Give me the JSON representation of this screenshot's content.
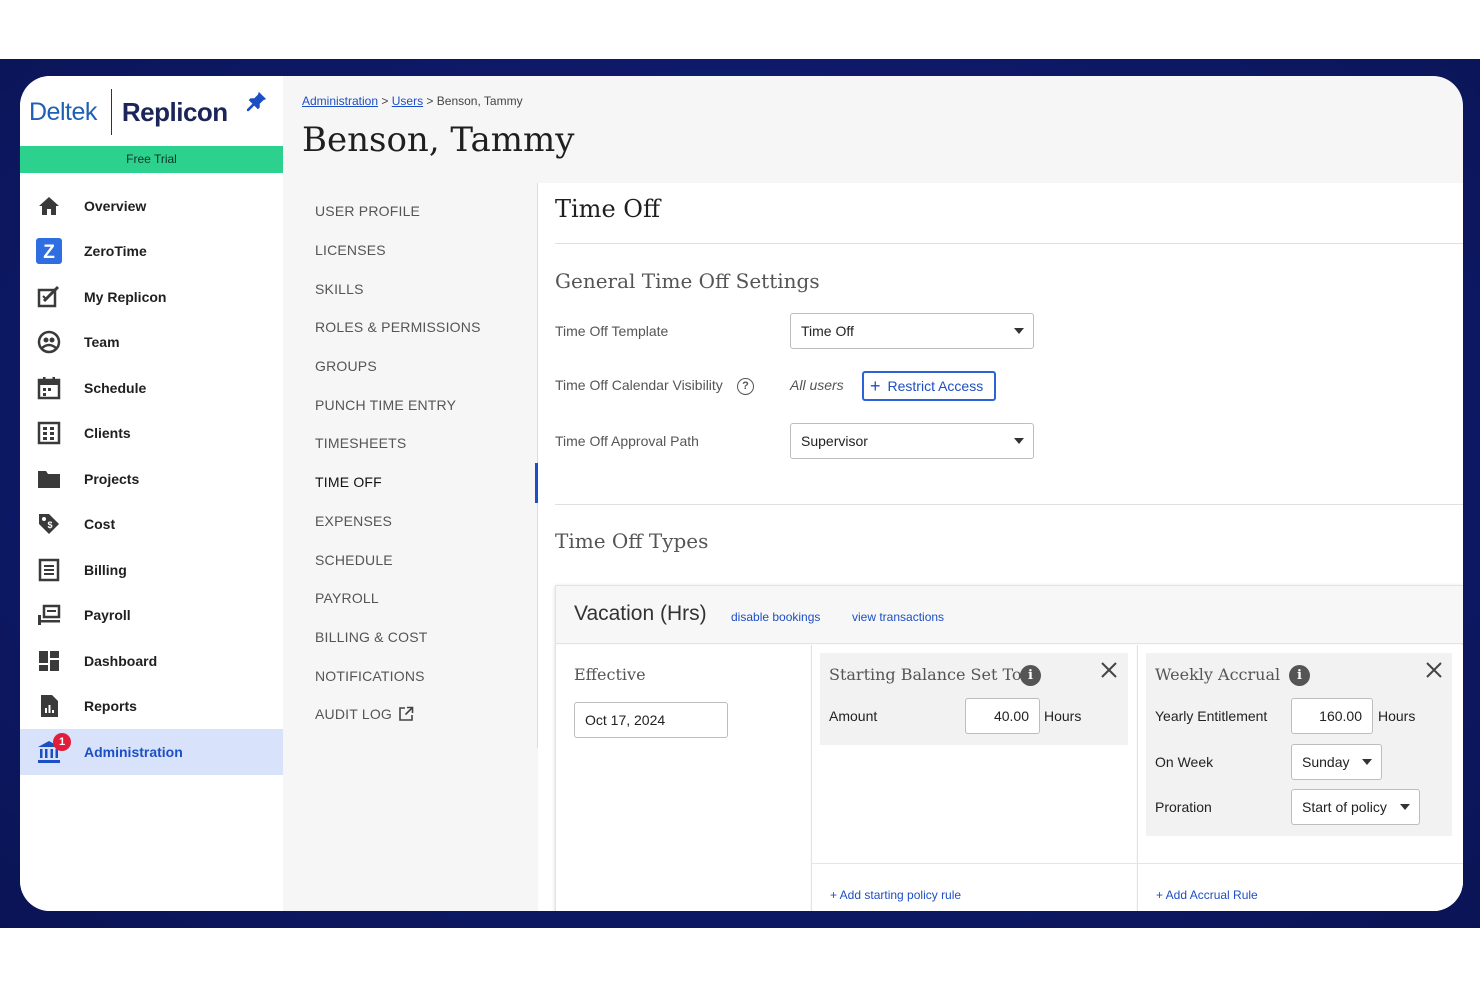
{
  "brand": {
    "company": "Deltek",
    "product": "Replicon",
    "trial_label": "Free Trial",
    "accent_color": "#2bd18c",
    "primary_color": "#1d4fc4"
  },
  "sidebar": {
    "items": [
      {
        "label": "Overview",
        "icon": "home-icon"
      },
      {
        "label": "ZeroTime",
        "icon": "zerotime-icon"
      },
      {
        "label": "My Replicon",
        "icon": "my-replicon-icon"
      },
      {
        "label": "Team",
        "icon": "team-icon"
      },
      {
        "label": "Schedule",
        "icon": "calendar-icon"
      },
      {
        "label": "Clients",
        "icon": "clients-icon"
      },
      {
        "label": "Projects",
        "icon": "folder-icon"
      },
      {
        "label": "Cost",
        "icon": "tag-icon"
      },
      {
        "label": "Billing",
        "icon": "billing-icon"
      },
      {
        "label": "Payroll",
        "icon": "payroll-icon"
      },
      {
        "label": "Dashboard",
        "icon": "dashboard-icon"
      },
      {
        "label": "Reports",
        "icon": "reports-icon"
      },
      {
        "label": "Administration",
        "icon": "bank-icon",
        "badge": "1",
        "active": true
      }
    ]
  },
  "breadcrumb": {
    "items": [
      "Administration",
      "Users"
    ],
    "separator": ">",
    "current": "Benson, Tammy"
  },
  "page_title": "Benson, Tammy",
  "subnav": {
    "items": [
      "USER PROFILE",
      "LICENSES",
      "SKILLS",
      "ROLES & PERMISSIONS",
      "GROUPS",
      "PUNCH TIME ENTRY",
      "TIMESHEETS",
      "TIME OFF",
      "EXPENSES",
      "SCHEDULE",
      "PAYROLL",
      "BILLING & COST",
      "NOTIFICATIONS",
      "AUDIT LOG"
    ],
    "active": "TIME OFF"
  },
  "content": {
    "heading": "Time Off",
    "general": {
      "heading": "General Time Off Settings",
      "template_label": "Time Off Template",
      "template_value": "Time Off",
      "visibility_label": "Time Off Calendar Visibility",
      "visibility_value": "All users",
      "restrict_button": "Restrict Access",
      "approval_label": "Time Off Approval Path",
      "approval_value": "Supervisor"
    },
    "types_heading": "Time Off Types",
    "vacation": {
      "title": "Vacation (Hrs)",
      "disable_link": "disable bookings",
      "transactions_link": "view transactions",
      "effective_label": "Effective",
      "effective_date": "Oct 17, 2024",
      "starting": {
        "title": "Starting Balance Set To",
        "amount_label": "Amount",
        "amount_value": "40.00",
        "unit": "Hours",
        "add_link": "+ Add starting policy rule"
      },
      "accrual": {
        "title": "Weekly Accrual",
        "entitlement_label": "Yearly Entitlement",
        "entitlement_value": "160.00",
        "unit": "Hours",
        "week_label": "On Week",
        "week_value": "Sunday",
        "proration_label": "Proration",
        "proration_value": "Start of policy",
        "add_link": "+ Add Accrual Rule"
      }
    }
  }
}
